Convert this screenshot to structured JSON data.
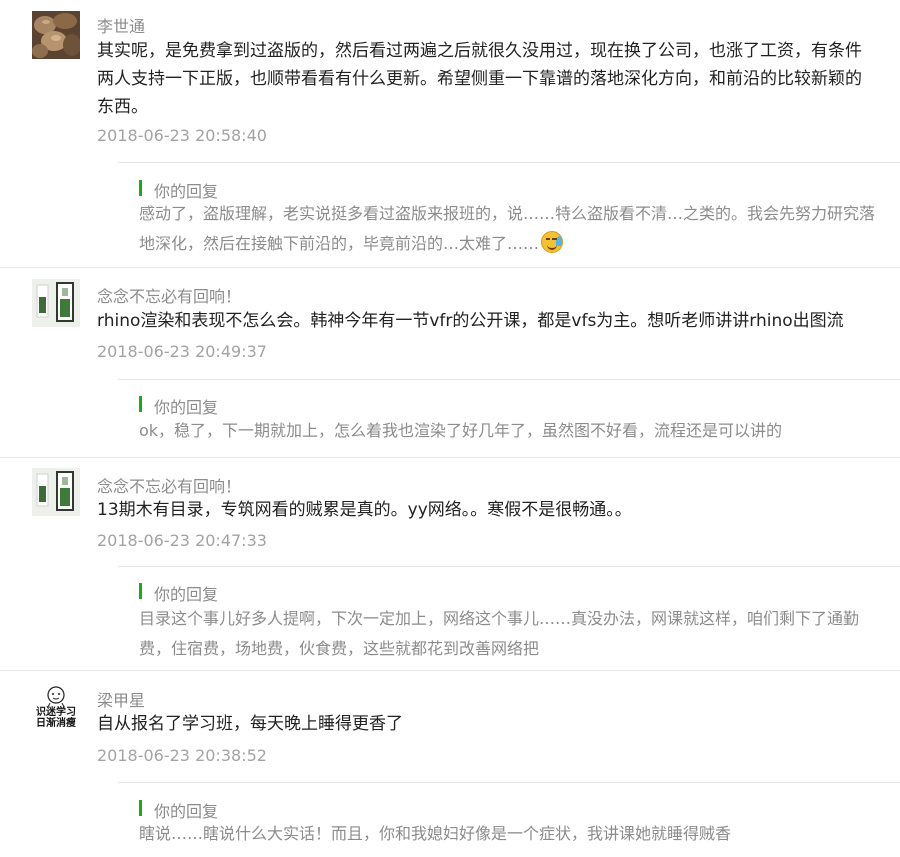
{
  "comments": [
    {
      "nickname": "李世通",
      "avatar_icon": "mushroom-photo-avatar",
      "content": "其实呢，是免费拿到过盗版的，然后看过两遍之后就很久没用过，现在换了公司，也涨了工资，有条件两人支持一下正版，也顺带看看有什么更新。希望侧重一下靠谱的落地深化方向，和前沿的比较新颖的东西。",
      "time": "2018-06-23 20:58:40",
      "reply_label": "你的回复",
      "reply_text": "感动了，盗版理解，老实说挺多看过盗版来报班的，说……特么盗版看不清…之类的。我会先努力研究落地深化，然后在接触下前沿的，毕竟前沿的…太难了……",
      "reply_emoji": "laughing-tears-emoji"
    },
    {
      "nickname": "念念不忘必有回响！",
      "avatar_icon": "wall-art-photo-avatar",
      "content": "rhino渲染和表现不怎么会。韩神今年有一节vfr的公开课，都是vfs为主。想听老师讲讲rhino出图流",
      "time": "2018-06-23 20:49:37",
      "reply_label": "你的回复",
      "reply_text": "ok，稳了，下一期就加上，怎么着我也渲染了好几年了，虽然图不好看，流程还是可以讲的"
    },
    {
      "nickname": "念念不忘必有回响！",
      "avatar_icon": "wall-art-photo-avatar",
      "content": "13期木有目录，专筑网看的贼累是真的。yy网络。。寒假不是很畅通。。",
      "time": "2018-06-23 20:47:33",
      "reply_label": "你的回复",
      "reply_text": "目录这个事儿好多人提啊，下次一定加上，网络这个事儿……真没办法，网课就这样，咱们剩下了通勤费，住宿费，场地费，伙食费，这些就都花到改善网络把"
    },
    {
      "nickname": "梁甲星",
      "avatar_icon": "cartoon-sticker-avatar",
      "avatar_text_line1": "识迷学习",
      "avatar_text_line2": "日渐消瘦",
      "content": "自从报名了学习班，每天晚上睡得更香了",
      "time": "2018-06-23 20:38:52",
      "reply_label": "你的回复",
      "reply_text": "瞎说……瞎说什么大实话！而且，你和我媳妇好像是一个症状，我讲课她就睡得贼香"
    }
  ],
  "colors": {
    "reply_accent": "#1aad19",
    "meta_gray": "#a3a3a3",
    "text_dark": "#222222"
  }
}
